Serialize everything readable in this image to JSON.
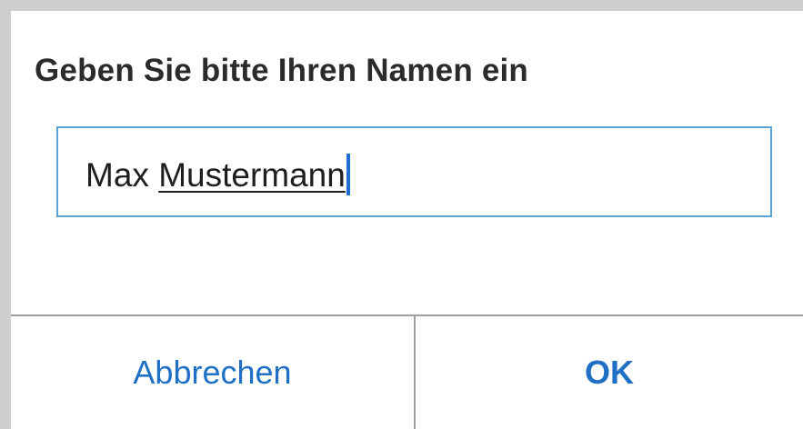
{
  "dialog": {
    "title": "Geben Sie bitte Ihren Namen ein",
    "input": {
      "value_plain": "Max ",
      "value_composing": "Mustermann"
    },
    "buttons": {
      "cancel_label": "Abbrechen",
      "ok_label": "OK"
    }
  },
  "colors": {
    "accent": "#1f6fc4",
    "input_border": "#5ba3d4",
    "caret": "#1f6fd1",
    "divider": "#9e9e9e",
    "title_text": "#2b2b2b"
  }
}
